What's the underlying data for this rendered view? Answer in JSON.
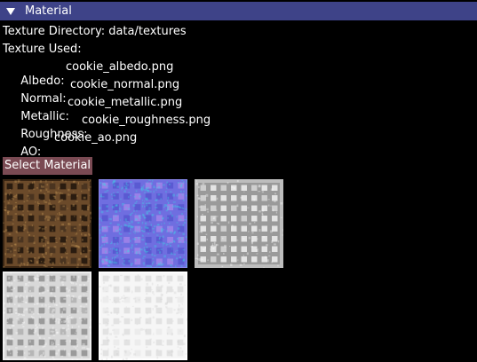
{
  "panel": {
    "title": "Material",
    "expanded_icon": "triangle-down-icon"
  },
  "info": {
    "directory_line": "Texture Directory: data/textures",
    "used_label": "Texture Used:"
  },
  "textures": [
    {
      "label": "Albedo:",
      "file": "cookie_albedo.png"
    },
    {
      "label": "Normal:",
      "file": "cookie_normal.png"
    },
    {
      "label": "Metallic:",
      "file": "cookie_metallic.png"
    },
    {
      "label": "Roughness:",
      "file": "cookie_roughness.png"
    },
    {
      "label": "AO:",
      "file": "cookie_ao.png"
    }
  ],
  "select_button": {
    "label": "Select Material"
  },
  "colors": {
    "header_bg": "#3e4388",
    "button_bg": "#7a4a53",
    "albedo_base": "#6b4a2a",
    "normal_base": "#6f6ee0",
    "metallic_base": "#9a9a9a",
    "roughness_base": "#d8d8d8",
    "ao_base": "#f6f6f6"
  }
}
